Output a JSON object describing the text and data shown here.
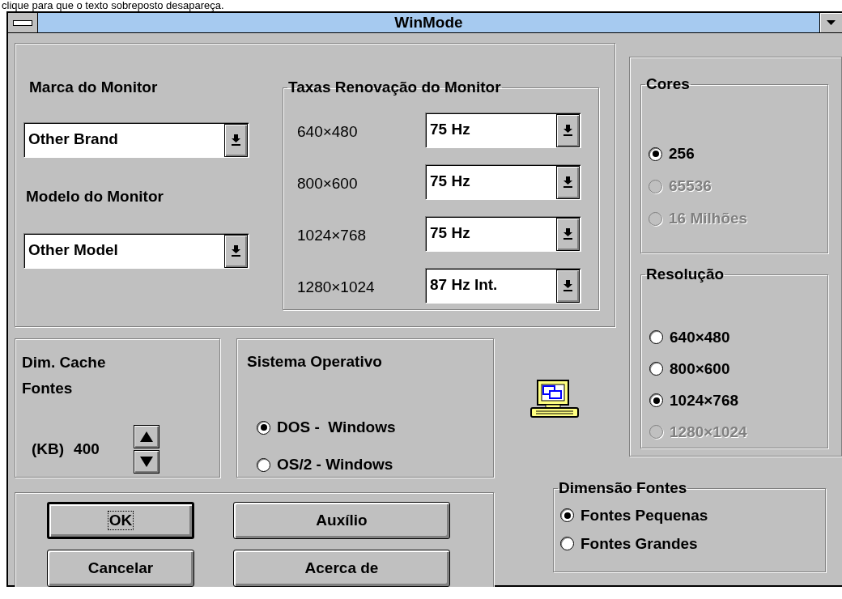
{
  "caption": "clique para que o texto sobreposto desapareça.",
  "window": {
    "title": "WinMode"
  },
  "monitor": {
    "brand_label": "Marca do Monitor",
    "brand": "Other Brand",
    "model_label": "Modelo do Monitor",
    "model": "Other Model",
    "refresh_rates": {
      "title": "Taxas Renovação do Monitor",
      "rows": [
        {
          "resolution": "640×480",
          "rate": "75 Hz"
        },
        {
          "resolution": "800×600",
          "rate": "75 Hz"
        },
        {
          "resolution": "1024×768",
          "rate": "75 Hz"
        },
        {
          "resolution": "1280×1024",
          "rate": "87 Hz Int."
        }
      ]
    }
  },
  "colors": {
    "title": "Cores",
    "options": [
      {
        "label": "256",
        "selected": true,
        "disabled": false
      },
      {
        "label": "65536",
        "selected": false,
        "disabled": true
      },
      {
        "label": "16 Milhões",
        "selected": false,
        "disabled": true
      }
    ]
  },
  "resolution": {
    "title": "Resolução",
    "options": [
      {
        "label": "640×480",
        "selected": false,
        "disabled": false
      },
      {
        "label": "800×600",
        "selected": false,
        "disabled": false
      },
      {
        "label": "1024×768",
        "selected": true,
        "disabled": false
      },
      {
        "label": "1280×1024",
        "selected": false,
        "disabled": true
      }
    ]
  },
  "font_cache": {
    "label": "Dim. Cache Fontes",
    "unit": "(KB)",
    "value": "400"
  },
  "operating_system": {
    "title": "Sistema Operativo",
    "options": [
      {
        "label": "DOS -  Windows",
        "selected": true
      },
      {
        "label": "OS/2 - Windows",
        "selected": false
      }
    ]
  },
  "buttons": [
    {
      "label": "OK",
      "default": true
    },
    {
      "label": "Auxílio",
      "default": false
    },
    {
      "label": "Cancelar",
      "default": false
    },
    {
      "label": "Acerca de",
      "default": false
    }
  ],
  "font_size": {
    "title": "Dimensão Fontes",
    "options": [
      {
        "label": "Fontes Pequenas",
        "selected": true
      },
      {
        "label": "Fontes Grandes",
        "selected": false
      }
    ]
  }
}
